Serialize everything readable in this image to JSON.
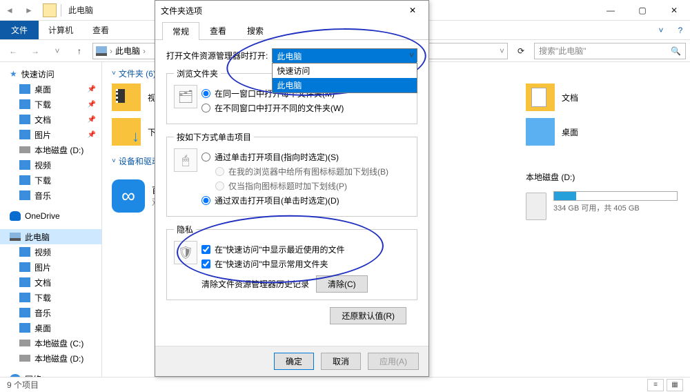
{
  "window": {
    "title": "此电脑",
    "file_tab": "文件",
    "ribbon_tabs": [
      "计算机",
      "查看"
    ],
    "addr": "此电脑",
    "addr_chev": "›",
    "search_placeholder": "搜索\"此电脑\"",
    "min": "—",
    "max": "▢",
    "close": "✕",
    "help": "?",
    "chev_down": "˅"
  },
  "sidebar": {
    "quick": "快速访问",
    "desktop": "桌面",
    "downloads": "下载",
    "documents": "文档",
    "pictures": "图片",
    "local_d": "本地磁盘 (D:)",
    "video": "视频",
    "downloads2": "下载",
    "music": "音乐",
    "onedrive": "OneDrive",
    "thispc": "此电脑",
    "pc_video": "视频",
    "pc_pictures": "图片",
    "pc_documents": "文档",
    "pc_downloads": "下载",
    "pc_music": "音乐",
    "pc_desktop": "桌面",
    "disk_c": "本地磁盘 (C:)",
    "disk_d": "本地磁盘 (D:)",
    "network": "网络"
  },
  "content": {
    "folders_head": "文件夹 (6)",
    "devices_head": "设备和驱动",
    "video": "视频",
    "downloads": "下载",
    "documents": "文档",
    "desktop": "桌面",
    "baidu_name": "百度",
    "baidu_sub": "双击",
    "disk_d": "本地磁盘 (D:)",
    "disk_d_text": "334 GB 可用，共 405 GB",
    "disk_d_fill_pct": 18
  },
  "status": {
    "items": "9 个项目"
  },
  "dialog": {
    "title": "文件夹选项",
    "close": "✕",
    "tabs": [
      "常规",
      "查看",
      "搜索"
    ],
    "open_label": "打开文件资源管理器时打开:",
    "select_value": "此电脑",
    "dropdown": [
      "快速访问",
      "此电脑"
    ],
    "browse_legend": "浏览文件夹",
    "browse_same": "在同一窗口中打开每个文件夹(M)",
    "browse_diff": "在不同窗口中打开不同的文件夹(W)",
    "click_legend": "按如下方式单击项目",
    "click_single": "通过单击打开项目(指向时选定)(S)",
    "click_single_a": "在我的浏览器中给所有图标标题加下划线(B)",
    "click_single_b": "仅当指向图标标题时加下划线(P)",
    "click_double": "通过双击打开项目(单击时选定)(D)",
    "privacy_legend": "隐私",
    "priv_recent": "在\"快速访问\"中显示最近使用的文件",
    "priv_freq": "在\"快速访问\"中显示常用文件夹",
    "clear_label": "清除文件资源管理器历史记录",
    "clear_btn": "清除(C)",
    "restore_btn": "还原默认值(R)",
    "ok": "确定",
    "cancel": "取消",
    "apply": "应用(A)"
  }
}
